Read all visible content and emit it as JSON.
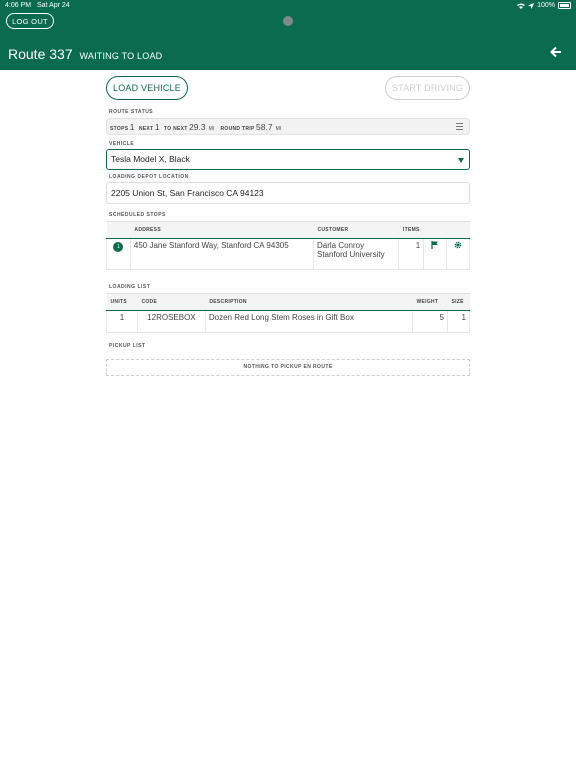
{
  "status_bar": {
    "time": "4:06 PM",
    "date": "Sat Apr 24",
    "battery": "100%"
  },
  "header": {
    "logout_label": "LOG OUT",
    "route_name": "Route 337",
    "route_status": "WAITING TO LOAD"
  },
  "actions": {
    "load_label": "LOAD VEHICLE",
    "start_label": "START DRIVING"
  },
  "route_status": {
    "label": "ROUTE STATUS",
    "stops_label": "STOPS",
    "stops_value": "1",
    "next_label": "NEXT",
    "next_value": "1",
    "to_next_label": "TO NEXT",
    "to_next_value": "29.3",
    "to_next_unit": "MI",
    "round_trip_label": "ROUND TRIP",
    "round_trip_value": "58.7",
    "round_trip_unit": "MI"
  },
  "vehicle": {
    "label": "VEHICLE",
    "selected": "Tesla Model X, Black"
  },
  "depot": {
    "label": "LOADING DEPOT LOCATION",
    "value": "2205 Union St, San Francisco CA 94123"
  },
  "scheduled_stops": {
    "label": "SCHEDULED STOPS",
    "headers": {
      "address": "ADDRESS",
      "customer": "CUSTOMER",
      "items": "ITEMS"
    },
    "rows": [
      {
        "number": "1",
        "address": "450 Jane Stanford Way, Stanford CA 94305",
        "customer_name": "Darla Conroy",
        "customer_org": "Stanford University",
        "items": "1"
      }
    ]
  },
  "loading_list": {
    "label": "LOADING LIST",
    "headers": {
      "units": "UNITS",
      "code": "CODE",
      "description": "DESCRIPTION",
      "weight": "WEIGHT",
      "size": "SIZE"
    },
    "rows": [
      {
        "units": "1",
        "code": "12ROSEBOX",
        "description": "Dozen Red Long Stem Roses in Gift Box",
        "weight": "5",
        "size": "1"
      }
    ]
  },
  "pickup_list": {
    "label": "PICKUP LIST",
    "empty_text": "NOTHING TO PICKUP EN ROUTE"
  },
  "colors": {
    "brand": "#0a6b4f",
    "disabled": "#cfcfcf"
  }
}
